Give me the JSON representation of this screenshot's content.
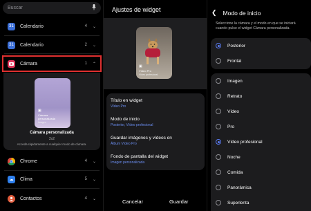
{
  "panel1": {
    "search_placeholder": "Buscar",
    "apps": [
      {
        "name": "Calendario",
        "count": "4",
        "color": "#3b6fd8",
        "icon": "calendar-icon"
      },
      {
        "name": "Calendario",
        "count": "2",
        "color": "#3b6fd8",
        "icon": "calendar-icon"
      },
      {
        "name": "Cámara",
        "count": "1",
        "color": "#e0365a",
        "icon": "camera-icon"
      },
      {
        "name": "Chrome",
        "count": "4",
        "color": "#34a853",
        "icon": "chrome-icon"
      },
      {
        "name": "Clima",
        "count": "5",
        "color": "#2f80ed",
        "icon": "weather-icon"
      },
      {
        "name": "Contactos",
        "count": "4",
        "color": "#e05a3a",
        "icon": "contacts-icon"
      }
    ],
    "widget_preview": {
      "line1": "Cámara",
      "line2": "personalizada",
      "line3": "Imagen"
    },
    "widget_title": "Cámara personalizada",
    "widget_size": "2x2",
    "widget_desc": "Acceda rápidamente a cualquier modo de cámara."
  },
  "panel2": {
    "title": "Ajustes de widget",
    "preview_line1": "Vídeo Pro",
    "preview_line2": "Vídeo profesional",
    "settings": [
      {
        "label": "Título en widget",
        "value": "Vídeo Pro"
      },
      {
        "label": "Modo de inicio",
        "value": "Posterior, Vídeo profesional"
      },
      {
        "label": "Guardar imágenes y vídeos en",
        "value": "Álbum Vídeo Pro"
      },
      {
        "label": "Fondo de pantalla del widget",
        "value": "Imagen personalizada"
      }
    ],
    "cancel_label": "Cancelar",
    "save_label": "Guardar"
  },
  "panel3": {
    "title": "Modo de inicio",
    "description": "Seleccione la cámara y el modo en que se iniciará cuando pulse el widget Cámara personalizada.",
    "cameras": [
      {
        "label": "Posterior",
        "selected": true
      },
      {
        "label": "Frontal",
        "selected": false
      }
    ],
    "modes": [
      {
        "label": "Imagen",
        "selected": false
      },
      {
        "label": "Retrato",
        "selected": false
      },
      {
        "label": "Vídeo",
        "selected": false
      },
      {
        "label": "Pro",
        "selected": false
      },
      {
        "label": "Vídeo profesional",
        "selected": true
      },
      {
        "label": "Noche",
        "selected": false
      },
      {
        "label": "Comida",
        "selected": false
      },
      {
        "label": "Panorámica",
        "selected": false
      },
      {
        "label": "Superlenta",
        "selected": false
      }
    ],
    "accent_color": "#5b7cf3"
  }
}
